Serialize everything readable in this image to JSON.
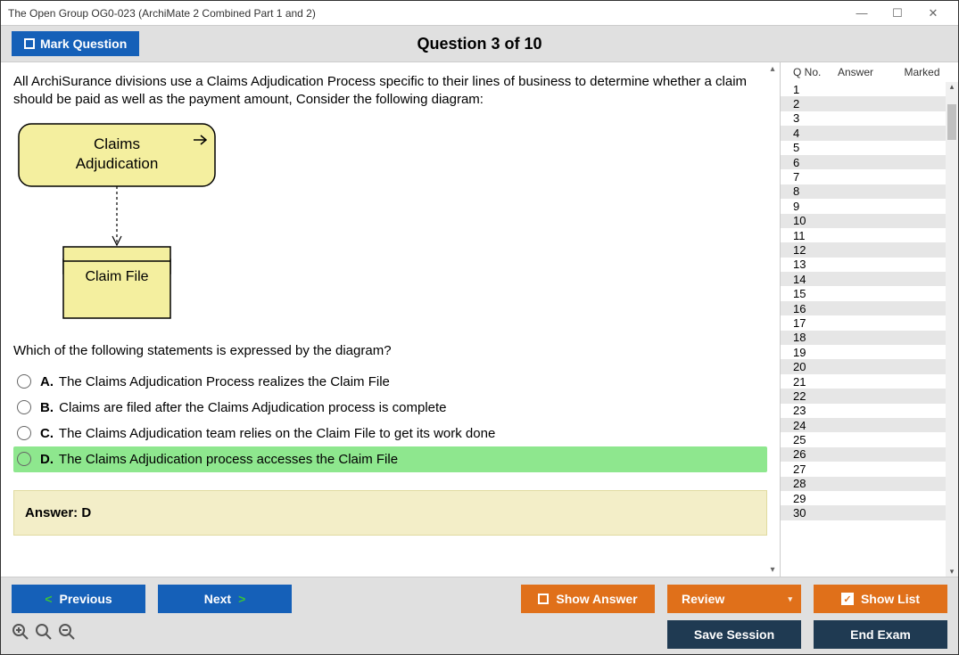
{
  "titlebar": {
    "text": "The Open Group OG0-023 (ArchiMate 2 Combined Part 1 and 2)"
  },
  "header": {
    "mark_label": "Mark Question",
    "question_title": "Question 3 of 10"
  },
  "question": {
    "text": "All ArchiSurance divisions use a Claims Adjudication Process specific to their lines of business to determine whether a claim should be paid as well as the payment amount, Consider the following diagram:",
    "prompt": "Which of the following statements is expressed by the diagram?"
  },
  "diagram": {
    "box1_line1": "Claims",
    "box1_line2": "Adjudication",
    "box2": "Claim File"
  },
  "options": {
    "a": {
      "label": "A.",
      "text": "The Claims Adjudication Process realizes the Claim File"
    },
    "b": {
      "label": "B.",
      "text": "Claims are filed after the Claims Adjudication process is complete"
    },
    "c": {
      "label": "C.",
      "text": "The Claims Adjudication team relies on the Claim File to get its work done"
    },
    "d": {
      "label": "D.",
      "text": "The Claims Adjudication process accesses the Claim File"
    }
  },
  "answer": {
    "text": "Answer: D"
  },
  "sidebar": {
    "cols": {
      "qno": "Q No.",
      "answer": "Answer",
      "marked": "Marked"
    },
    "rows": [
      "1",
      "2",
      "3",
      "4",
      "5",
      "6",
      "7",
      "8",
      "9",
      "10",
      "11",
      "12",
      "13",
      "14",
      "15",
      "16",
      "17",
      "18",
      "19",
      "20",
      "21",
      "22",
      "23",
      "24",
      "25",
      "26",
      "27",
      "28",
      "29",
      "30"
    ]
  },
  "footer": {
    "previous": "Previous",
    "next": "Next",
    "show_answer": "Show Answer",
    "review": "Review",
    "show_list": "Show List",
    "save_session": "Save Session",
    "end_exam": "End Exam"
  }
}
